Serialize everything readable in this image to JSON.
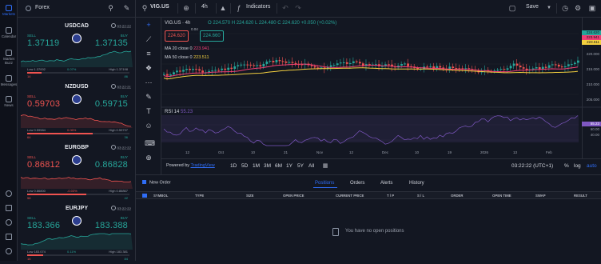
{
  "nav": {
    "items": [
      {
        "label": "Markets",
        "icon": "markets-icon",
        "active": true
      },
      {
        "label": "Calendar",
        "icon": "calendar-icon"
      },
      {
        "label": "Market Buzz",
        "icon": "market-buzz-icon"
      },
      {
        "label": "Messages",
        "icon": "messages-icon"
      },
      {
        "label": "News",
        "icon": "news-icon"
      }
    ]
  },
  "watchlist": {
    "title": "Forex",
    "cards": [
      {
        "symbol": "USDCAD",
        "time": "03:22:22",
        "sell_label": "SELL",
        "buy_label": "BUY",
        "sell_price": "1.37119",
        "buy_price": "1.37135",
        "low": "Low 1.37002",
        "high": "High 1.37198",
        "change": "0.07%",
        "sell_pct": 14,
        "buy_pct": 86,
        "trend": "up"
      },
      {
        "symbol": "NZDUSD",
        "time": "03:22:21",
        "sell_label": "SELL",
        "buy_label": "BUY",
        "sell_price": "0.59703",
        "buy_price": "0.59715",
        "low": "Low 0.59584",
        "high": "High 0.59737",
        "change": "0.06%",
        "sell_pct": 64,
        "buy_pct": 36,
        "trend": "down"
      },
      {
        "symbol": "EURGBP",
        "time": "03:22:22",
        "sell_label": "SELL",
        "buy_label": "BUY",
        "sell_price": "0.86812",
        "buy_price": "0.86828",
        "low": "Low 0.86800",
        "high": "High 0.86867",
        "change": "-0.03%",
        "sell_pct": 58,
        "buy_pct": 42,
        "trend": "down"
      },
      {
        "symbol": "EURJPY",
        "time": "03:22:22",
        "sell_label": "SELL",
        "buy_label": "BUY",
        "sell_price": "183.366",
        "buy_price": "183.388",
        "low": "Low 183.074",
        "high": "High 183.381",
        "change": "0.11%",
        "sell_pct": 16,
        "buy_pct": 84,
        "trend": "up"
      }
    ]
  },
  "toolbar": {
    "symbol": "VIG.US",
    "interval": "4h",
    "indicators_label": "Indicators",
    "save_label": "Save"
  },
  "chart": {
    "header": "VIG.US · 4h",
    "ohlc": "O 224.570  H 224.620  L 224.480  C 224.620 +0.050 (+0.02%)",
    "sell_box": "224.620",
    "spread": "0.04",
    "buy_box": "224.660",
    "ma20_label": "MA 20 close 0",
    "ma20_value": "223.941",
    "ma50_label": "MA 50 close 0",
    "ma50_value": "223.511",
    "rsi_label": "RSI 14",
    "rsi_value": "55.23",
    "price_ticks": [
      "225.000",
      "220.000",
      "215.000",
      "210.000",
      "205.000",
      "200.000"
    ],
    "rsi_ticks": [
      "60.00",
      "40.00"
    ],
    "tags": {
      "last": "224.620",
      "ma20": "223.941",
      "ma50": "223.511",
      "rsi": "55.23"
    },
    "time_ticks": [
      "12",
      "Oct",
      "10",
      "21",
      "Nov",
      "12",
      "Dec",
      "10",
      "19",
      "2026",
      "13",
      "Feb"
    ],
    "colors": {
      "up": "#26a69a",
      "down": "#ef5350",
      "ma20": "#f23f74",
      "ma50": "#f4d03f",
      "rsi": "#7e57c2"
    }
  },
  "range_bar": {
    "powered": "Powered by",
    "brand": "TradingView",
    "ranges": [
      "1D",
      "5D",
      "1M",
      "3M",
      "6M",
      "1Y",
      "5Y",
      "All"
    ],
    "clock": "03:22:22 (UTC+1)",
    "pct": "%",
    "log": "log",
    "auto": "auto"
  },
  "bottom": {
    "new_order": "New Order",
    "tabs": [
      "Positions",
      "Orders",
      "Alerts",
      "History"
    ],
    "columns": [
      "SYMBOL",
      "TYPE",
      "SIZE",
      "OPEN PRICE",
      "CURRENT PRICE",
      "T / P",
      "S / L",
      "ORDER",
      "OPEN TIME",
      "SWAP",
      "RESULT"
    ],
    "empty_message": "You have no open positions"
  }
}
